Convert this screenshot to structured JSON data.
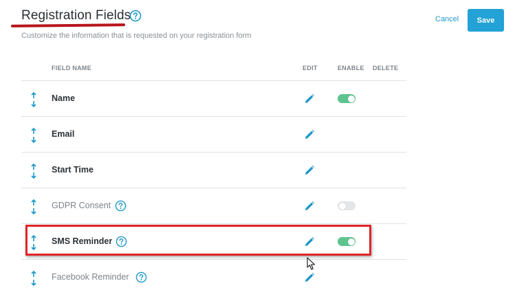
{
  "header": {
    "title": "Registration Fields",
    "subtitle": "Customize the information that is requested on your registration form",
    "cancel_label": "Cancel",
    "save_label": "Save"
  },
  "table": {
    "columns": [
      "FIELD NAME",
      "EDIT",
      "ENABLE",
      "DELETE"
    ],
    "rows": [
      {
        "label": "Name",
        "enabled": true,
        "has_toggle": true,
        "has_help": false,
        "muted": false
      },
      {
        "label": "Email",
        "has_toggle": false,
        "has_help": false,
        "muted": false
      },
      {
        "label": "Start Time",
        "has_toggle": false,
        "has_help": false,
        "muted": false
      },
      {
        "label": "GDPR Consent",
        "enabled": false,
        "has_toggle": true,
        "has_help": true,
        "muted": true
      },
      {
        "label": "SMS Reminder",
        "enabled": true,
        "has_toggle": true,
        "has_help": true,
        "muted": false,
        "highlighted": true
      },
      {
        "label": "Facebook Reminder",
        "has_toggle": false,
        "has_help": true,
        "muted": true
      }
    ]
  },
  "icons": {
    "title_help": "question-circle-icon",
    "drag": "up-down-arrow-icon",
    "edit": "pencil-icon",
    "row_help": "question-circle-icon"
  },
  "colors": {
    "accent": "#22a2d6",
    "toggle_on": "#5ec48f",
    "toggle_off": "#e3e5e7",
    "annotation_red": "#e02528",
    "underline_red": "#b7151b"
  }
}
